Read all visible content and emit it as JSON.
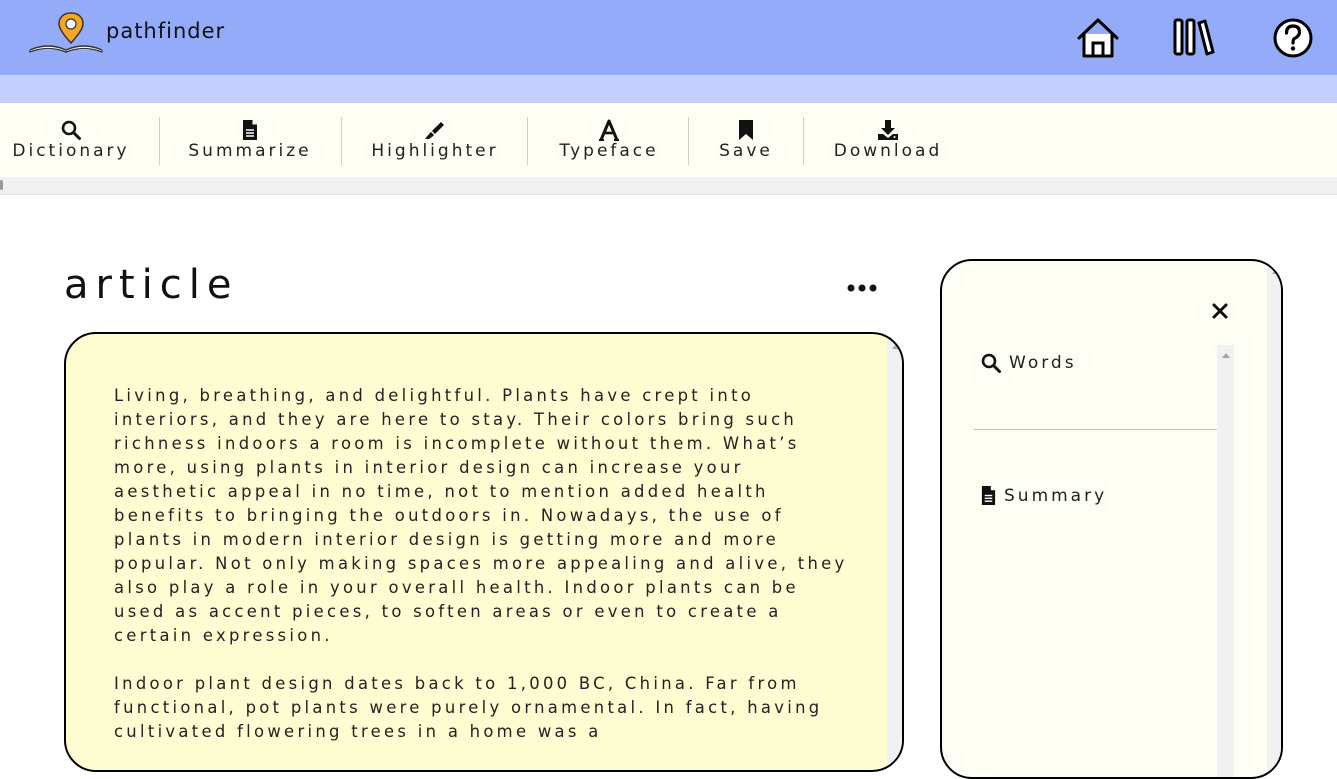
{
  "app": {
    "name": "pathfinder"
  },
  "header": {
    "icons": [
      "home-icon",
      "library-icon",
      "help-icon"
    ]
  },
  "toolbar": {
    "items": [
      {
        "label": "Dictionary",
        "icon": "search-icon"
      },
      {
        "label": "Summarize",
        "icon": "document-icon"
      },
      {
        "label": "Highlighter",
        "icon": "highlighter-icon"
      },
      {
        "label": "Typeface",
        "icon": "font-icon"
      },
      {
        "label": "Save",
        "icon": "bookmark-icon"
      },
      {
        "label": "Download",
        "icon": "download-icon"
      }
    ]
  },
  "article": {
    "title": "article",
    "paragraphs": [
      "Living, breathing, and delightful. Plants have crept into interiors, and they are here to stay. Their colors bring such richness indoors a room is incomplete without them. What’s more, using plants in interior design can increase your aesthetic appeal in no time, not to mention added health benefits to bringing the outdoors in. Nowadays, the use of plants in modern interior design is getting more and more popular. Not only making spaces more appealing and alive, they also play a role in your overall health. Indoor plants can be used as accent pieces, to soften areas or even to create a certain expression.",
      "Indoor plant design dates back to 1,000 BC, China. Far from functional, pot plants were purely ornamental. In fact, having cultivated flowering trees in a home was a"
    ]
  },
  "panel": {
    "words_label": "Words",
    "summary_label": "Summary"
  },
  "colors": {
    "header": "#94abfa",
    "subheader": "#c2cefc",
    "toolbar": "#fefef4",
    "article_bg": "#fdfdd1",
    "pin": "#f5a623"
  }
}
